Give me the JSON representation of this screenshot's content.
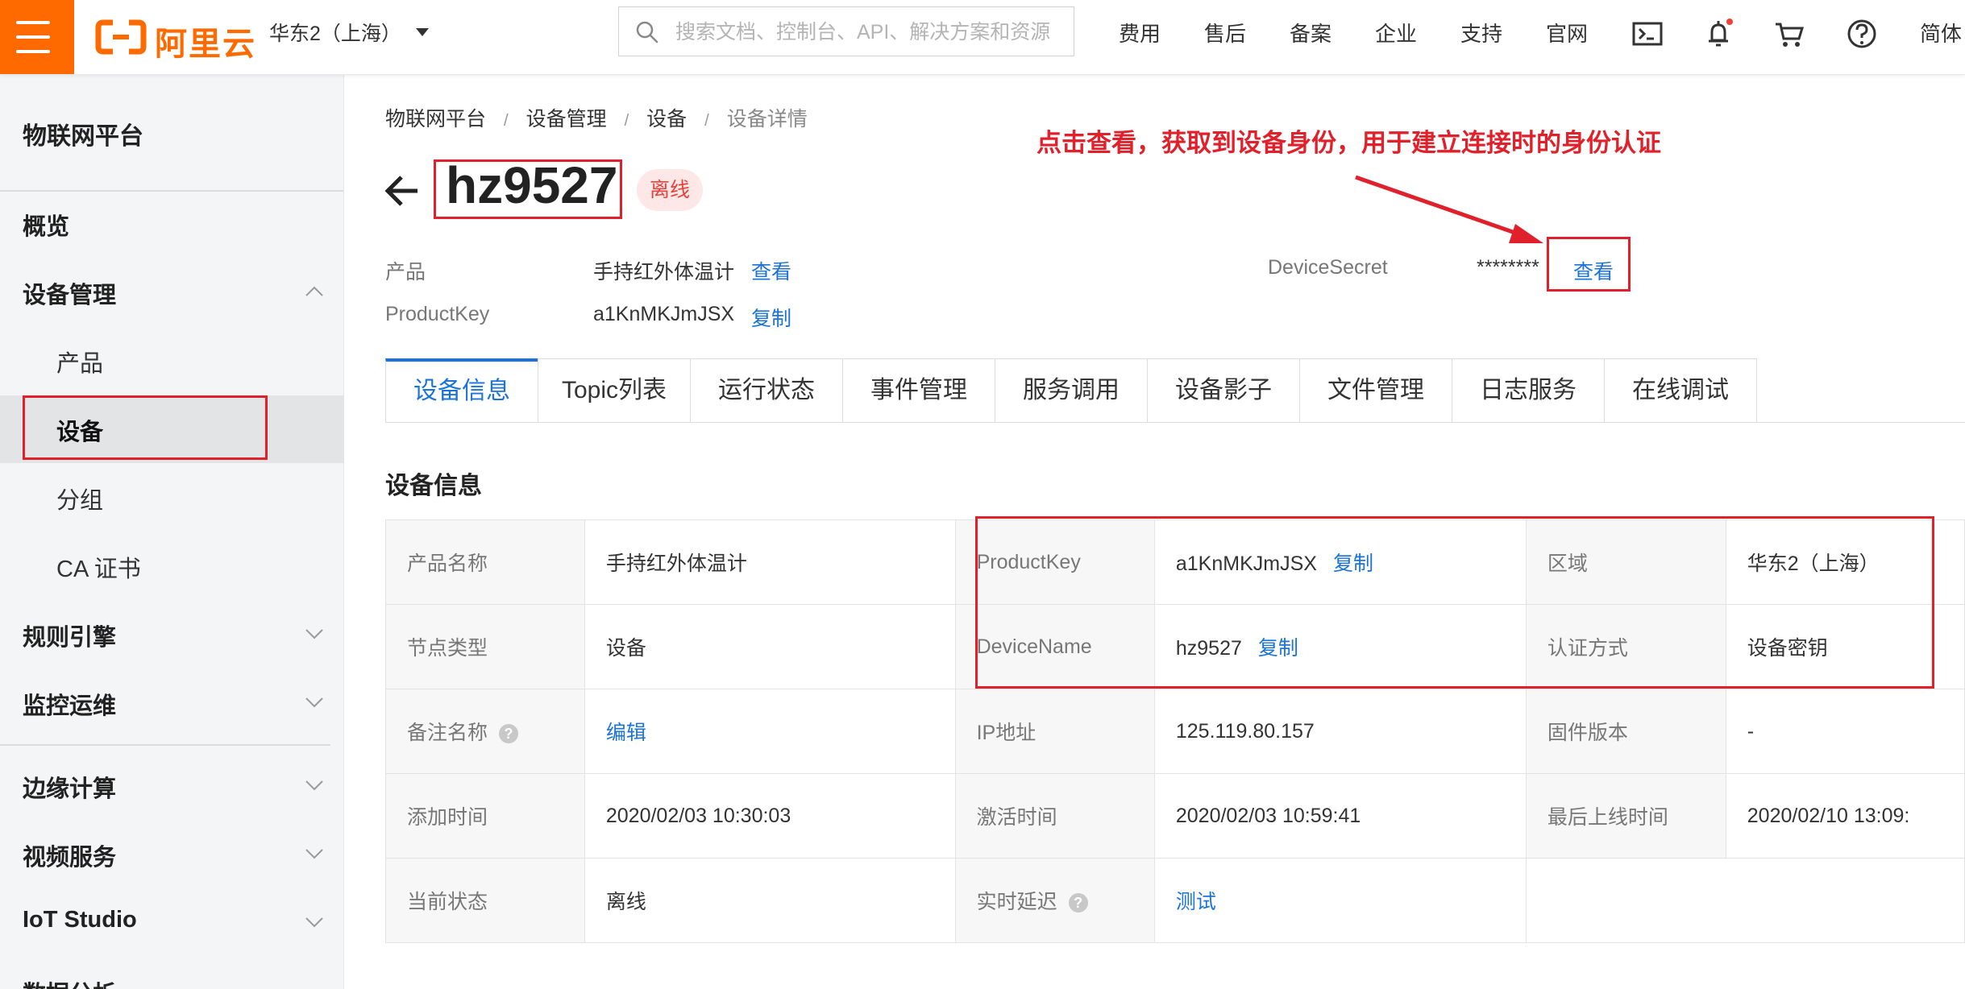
{
  "header": {
    "logo_text": "阿里云",
    "region": "华东2（上海）",
    "search_placeholder": "搜索文档、控制台、API、解决方案和资源",
    "nav": [
      "费用",
      "售后",
      "备案",
      "企业",
      "支持",
      "官网"
    ],
    "lang": "简体",
    "icons": [
      "menu-icon",
      "terminal-icon",
      "bell-icon",
      "cart-icon",
      "help-icon"
    ],
    "brand_color": "#ff6a00"
  },
  "sidebar": {
    "title": "物联网平台",
    "items": [
      {
        "label": "概览",
        "level": "top"
      },
      {
        "label": "设备管理",
        "level": "top",
        "expanded": true
      },
      {
        "label": "产品",
        "level": "sub"
      },
      {
        "label": "设备",
        "level": "sub",
        "active": true
      },
      {
        "label": "分组",
        "level": "sub"
      },
      {
        "label": "CA 证书",
        "level": "sub"
      },
      {
        "label": "规则引擎",
        "level": "top"
      },
      {
        "label": "监控运维",
        "level": "top"
      },
      {
        "label": "边缘计算",
        "level": "top"
      },
      {
        "label": "视频服务",
        "level": "top"
      },
      {
        "label": "IoT Studio",
        "level": "top"
      },
      {
        "label": "数据分析",
        "level": "top"
      }
    ]
  },
  "breadcrumb": [
    "物联网平台",
    "设备管理",
    "设备",
    "设备详情"
  ],
  "device": {
    "name": "hz9527",
    "status": "离线",
    "product_label": "产品",
    "product_value": "手持红外体温计",
    "product_link": "查看",
    "productkey_label": "ProductKey",
    "productkey_value": "a1KnMKJmJSX",
    "productkey_link": "复制",
    "secret_label": "DeviceSecret",
    "secret_value": "********",
    "secret_link": "查看"
  },
  "annotation": "点击查看，获取到设备身份，用于建立连接时的身份认证",
  "tabs": [
    "设备信息",
    "Topic列表",
    "运行状态",
    "事件管理",
    "服务调用",
    "设备影子",
    "文件管理",
    "日志服务",
    "在线调试"
  ],
  "active_tab": "设备信息",
  "section_title": "设备信息",
  "info": {
    "row1": {
      "k1": "产品名称",
      "v1": "手持红外体温计",
      "k2": "ProductKey",
      "v2": "a1KnMKJmJSX",
      "v2_link": "复制",
      "k3": "区域",
      "v3": "华东2（上海）"
    },
    "row2": {
      "k1": "节点类型",
      "v1": "设备",
      "k2": "DeviceName",
      "v2": "hz9527",
      "v2_link": "复制",
      "k3": "认证方式",
      "v3": "设备密钥"
    },
    "row3": {
      "k1": "备注名称",
      "v1": "编辑",
      "k2": "IP地址",
      "v2": "125.119.80.157",
      "k3": "固件版本",
      "v3": "-"
    },
    "row4": {
      "k1": "添加时间",
      "v1": "2020/02/03 10:30:03",
      "k2": "激活时间",
      "v2": "2020/02/03 10:59:41",
      "k3": "最后上线时间",
      "v3": "2020/02/10 13:09:"
    },
    "row5": {
      "k1": "当前状态",
      "v1": "离线",
      "k2": "实时延迟",
      "v2": "测试"
    },
    "help_glyph": "?"
  },
  "colors": {
    "link": "#1a73d8",
    "annotation_red": "#e0202a",
    "offline_badge_bg": "#fde8e7"
  }
}
